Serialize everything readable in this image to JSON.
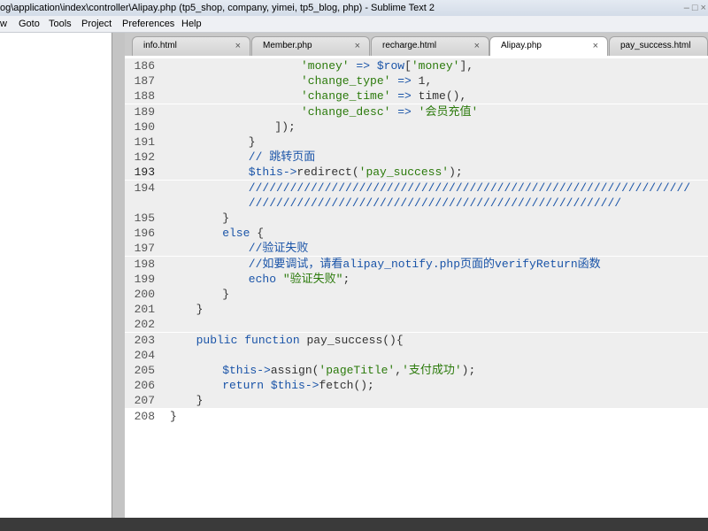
{
  "window": {
    "title": "og\\application\\index\\controller\\Alipay.php (tp5_shop, company, yimei, tp5_blog, php) - Sublime Text 2",
    "controls": "– □ ×"
  },
  "menu": [
    "w",
    "Goto",
    "Tools",
    "Project",
    "Preferences",
    "Help"
  ],
  "tabs": [
    {
      "label": "info.html",
      "close": "×"
    },
    {
      "label": "Member.php",
      "close": "×"
    },
    {
      "label": "recharge.html",
      "close": "×"
    },
    {
      "label": "Alipay.php",
      "close": "×"
    },
    {
      "label": "pay_success.html",
      "close": ""
    }
  ],
  "active_tab": "Alipay.php",
  "code_lines": [
    {
      "n": "186",
      "code": "'money' => $row['money'],"
    },
    {
      "n": "187",
      "code": "'change_type' => 1,"
    },
    {
      "n": "188",
      "code": "'change_time' => time(),"
    },
    {
      "n": "189",
      "code": "'change_desc' => '会员充值'"
    },
    {
      "n": "190",
      "code": "]);"
    },
    {
      "n": "191",
      "code": "}"
    },
    {
      "n": "192",
      "code": "// 跳转页面"
    },
    {
      "n": "193",
      "code": "$this->redirect('pay_success');"
    },
    {
      "n": "194",
      "code": "////////////////////////////////////////////////////////////////"
    },
    {
      "n": "",
      "code": "//////////////////////////////////////////////////////"
    },
    {
      "n": "195",
      "code": "}"
    },
    {
      "n": "196",
      "code": "else {"
    },
    {
      "n": "197",
      "code": "//验证失败"
    },
    {
      "n": "198",
      "code": "//如要调试，请看alipay_notify.php页面的verifyReturn函数"
    },
    {
      "n": "199",
      "code": "echo \"验证失败\";"
    },
    {
      "n": "200",
      "code": "}"
    },
    {
      "n": "201",
      "code": "}"
    },
    {
      "n": "202",
      "code": ""
    },
    {
      "n": "203",
      "code": "public function pay_success(){"
    },
    {
      "n": "204",
      "code": ""
    },
    {
      "n": "205",
      "code": "$this->assign('pageTitle','支付成功');"
    },
    {
      "n": "206",
      "code": "return $this->fetch();"
    },
    {
      "n": "207",
      "code": "}"
    },
    {
      "n": "208",
      "code": "}"
    }
  ],
  "current_line": "193",
  "colors": {
    "string": "#2b7a0b",
    "keyword": "#1a54a8",
    "variable": "#1a54a8",
    "comment": "#1a54a8",
    "tabbar": "#c9c9c9",
    "highlight": "#eeeeee"
  }
}
